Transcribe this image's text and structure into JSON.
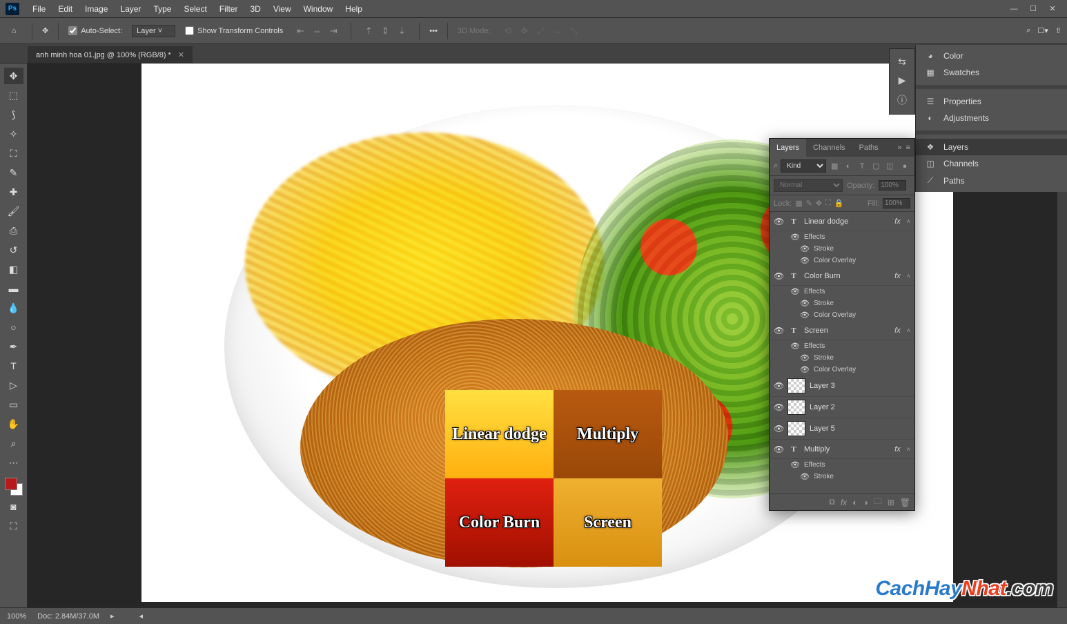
{
  "menubar": {
    "items": [
      "File",
      "Edit",
      "Image",
      "Layer",
      "Type",
      "Select",
      "Filter",
      "3D",
      "View",
      "Window",
      "Help"
    ]
  },
  "optbar": {
    "auto_select": "Auto-Select:",
    "layer_dd": "Layer",
    "show_transform": "Show Transform Controls",
    "mode3d": "3D Mode:"
  },
  "tab": {
    "title": "anh minh hoa 01.jpg @ 100% (RGB/8) *"
  },
  "canvas_labels": {
    "linear_dodge": "Linear dodge",
    "multiply": "Multiply",
    "color_burn": "Color Burn",
    "screen": "Screen"
  },
  "right_panels": {
    "color": "Color",
    "swatches": "Swatches",
    "properties": "Properties",
    "adjustments": "Adjustments",
    "layers": "Layers",
    "channels": "Channels",
    "paths": "Paths"
  },
  "layers_panel": {
    "tabs": [
      "Layers",
      "Channels",
      "Paths"
    ],
    "kind": "Kind",
    "blend": "Normal",
    "opacity_lbl": "Opacity:",
    "opacity_val": "100%",
    "lock_lbl": "Lock:",
    "fill_lbl": "Fill:",
    "fill_val": "100%",
    "effects": "Effects",
    "stroke": "Stroke",
    "color_overlay": "Color Overlay",
    "layers": [
      {
        "type": "T",
        "name": "Linear dodge",
        "fx": true,
        "effects": [
          "Stroke",
          "Color Overlay"
        ]
      },
      {
        "type": "T",
        "name": "Color Burn",
        "fx": true,
        "effects": [
          "Stroke",
          "Color Overlay"
        ]
      },
      {
        "type": "T",
        "name": "Screen",
        "fx": true,
        "effects": [
          "Stroke",
          "Color Overlay"
        ]
      },
      {
        "type": "thumb",
        "name": "Layer 3"
      },
      {
        "type": "thumb",
        "name": "Layer 2"
      },
      {
        "type": "thumb",
        "name": "Layer 5"
      },
      {
        "type": "T",
        "name": "Multiply",
        "fx": true,
        "effects": [
          "Stroke"
        ]
      }
    ]
  },
  "status": {
    "zoom": "100%",
    "doc": "Doc: 2.84M/37.0M"
  },
  "watermark": {
    "p1": "CachHay",
    "p2": "Nhat",
    "p3": ".com"
  }
}
